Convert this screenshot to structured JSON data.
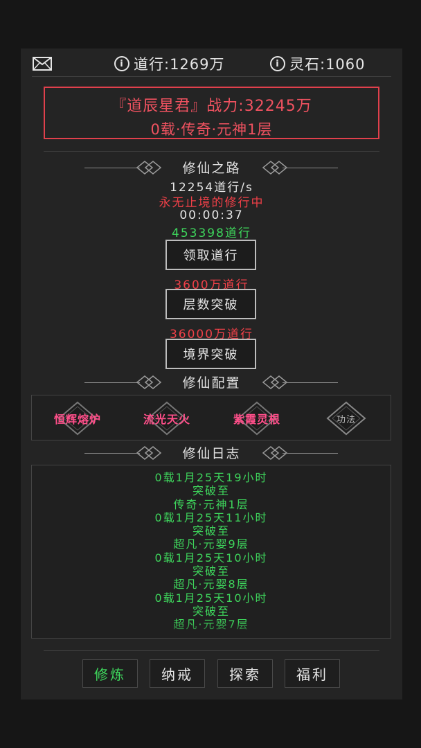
{
  "header": {
    "daoxing_label": "道行:1269万",
    "lingshi_label": "灵石:1060"
  },
  "identity": {
    "line1": "『道辰星君』战力:32245万",
    "line2": "0载·传奇·元神1层"
  },
  "cultivation": {
    "title": "修仙之路",
    "rate": "12254道行/s",
    "status": "永无止境的修行中",
    "timer": "00:00:37",
    "pending": "453398道行",
    "claim_button": "领取道行",
    "layer_cost": "3600万道行",
    "layer_button": "层数突破",
    "realm_cost": "36000万道行",
    "realm_button": "境界突破"
  },
  "config": {
    "title": "修仙配置",
    "slots": [
      "恒辉熔炉",
      "流光天火",
      "紫霞灵根",
      "功法"
    ]
  },
  "log": {
    "title": "修仙日志",
    "lines": [
      "0载1月25天19小时",
      "突破至",
      "传奇·元神1层",
      "0载1月25天11小时",
      "突破至",
      "超凡·元婴9层",
      "0载1月25天10小时",
      "突破至",
      "超凡·元婴8层",
      "0载1月25天10小时",
      "突破至",
      "超凡·元婴7层"
    ]
  },
  "nav": {
    "items": [
      "修炼",
      "纳戒",
      "探索",
      "福利"
    ],
    "active_index": 0
  },
  "colors": {
    "accent_red": "#f04048",
    "accent_green": "#3ed65c",
    "accent_pink": "#ff4f8a"
  }
}
